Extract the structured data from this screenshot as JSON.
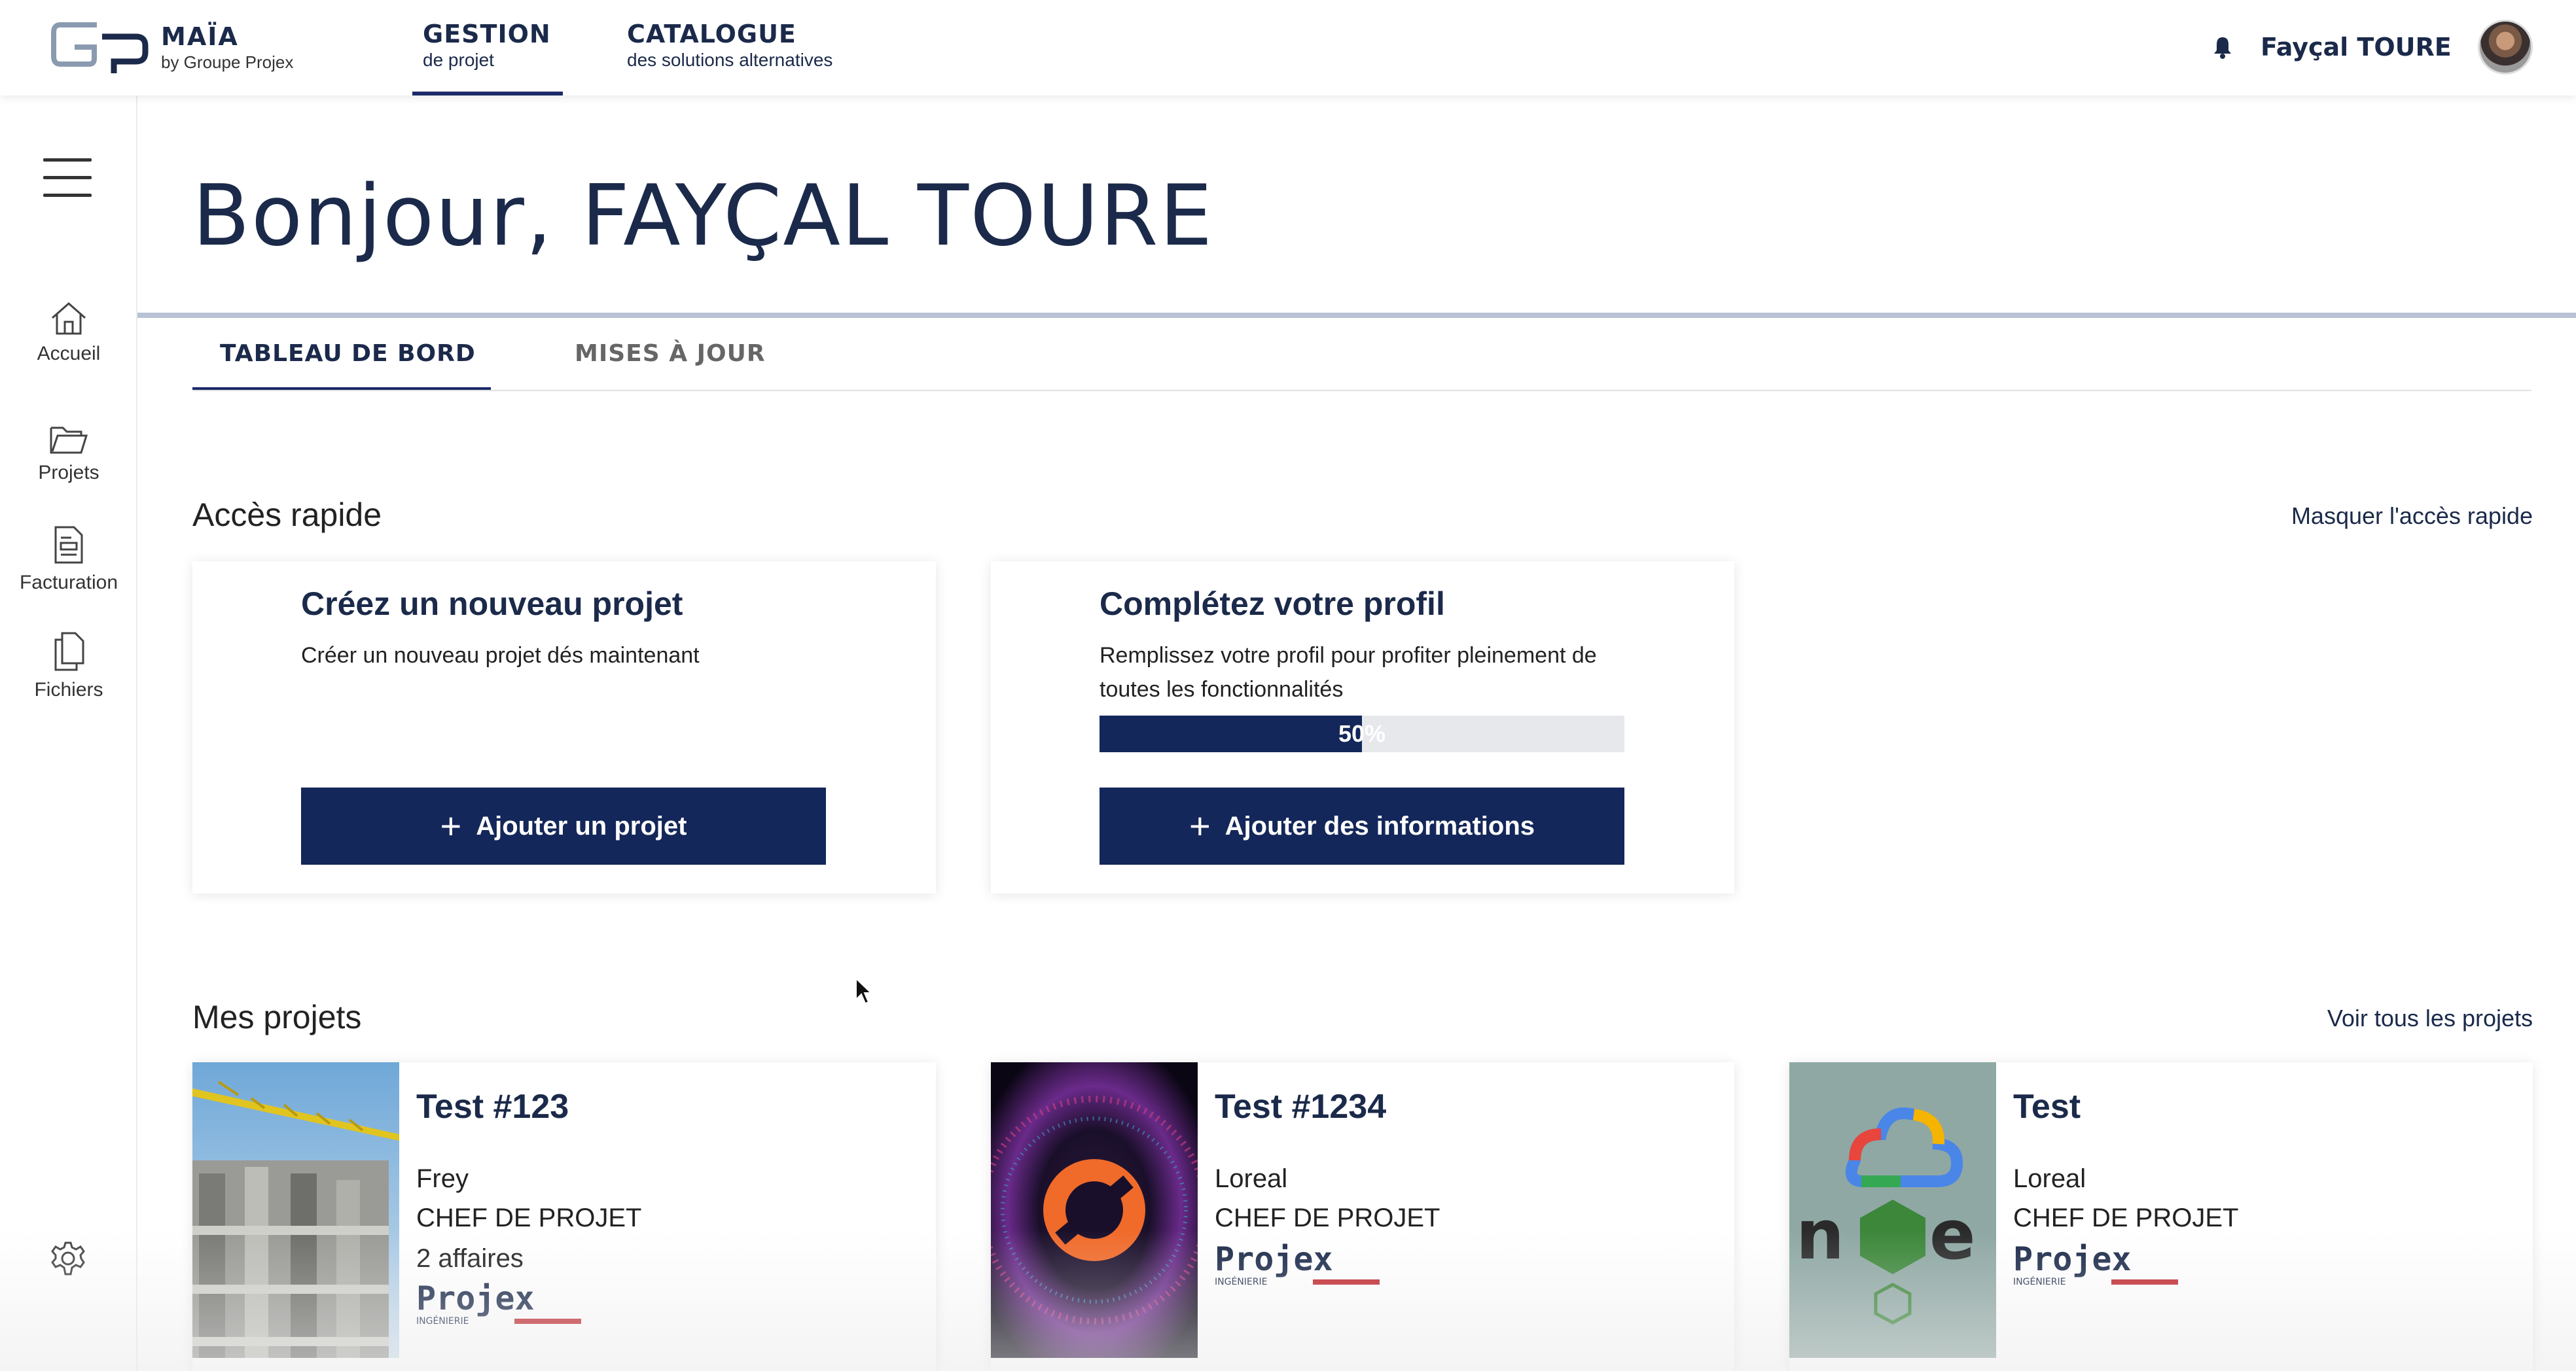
{
  "header": {
    "brand_name": "MAÏA",
    "brand_sub": "by Groupe Projex",
    "nav": [
      {
        "main": "GESTION",
        "sub": "de projet"
      },
      {
        "main": "CATALOGUE",
        "sub": "des solutions alternatives"
      }
    ],
    "bell_icon": "bell-icon",
    "user_name": "Fayçal TOURE"
  },
  "sidebar": {
    "menu_icon": "hamburger-menu-icon",
    "items": [
      {
        "icon": "home-icon",
        "label": "Accueil"
      },
      {
        "icon": "folder-icon",
        "label": "Projets"
      },
      {
        "icon": "invoice-icon",
        "label": "Facturation"
      },
      {
        "icon": "files-icon",
        "label": "Fichiers"
      }
    ],
    "settings_icon": "gear-icon"
  },
  "main": {
    "greeting": "Bonjour, FAYÇAL TOURE",
    "tabs": [
      {
        "label": "TABLEAU DE BORD",
        "active": true
      },
      {
        "label": "MISES À JOUR",
        "active": false
      }
    ]
  },
  "quick_access": {
    "title": "Accès rapide",
    "hide_link": "Masquer l'accès rapide",
    "cards": [
      {
        "title": "Créez un nouveau projet",
        "text": "Créer un nouveau projet dés maintenant",
        "button": "Ajouter un projet"
      },
      {
        "title": "Complétez votre profil",
        "text": "Remplissez votre profil pour profiter pleinement de toutes les fonctionnalités",
        "progress_percent": 50,
        "progress_label": "50%",
        "button": "Ajouter des informations"
      }
    ]
  },
  "projects": {
    "title": "Mes projets",
    "see_all_link": "Voir tous les projets",
    "items": [
      {
        "title": "Test #123",
        "client": "Frey",
        "role": "CHEF DE PROJET",
        "count": "2 affaires",
        "logo_text": "Projex",
        "logo_sub": "INGÉNIERIE"
      },
      {
        "title": "Test #1234",
        "client": "Loreal",
        "role": "CHEF DE PROJET",
        "logo_text": "Projex",
        "logo_sub": "INGÉNIERIE"
      },
      {
        "title": "Test",
        "client": "Loreal",
        "role": "CHEF DE PROJET",
        "logo_text": "Projex",
        "logo_sub": "INGÉNIERIE"
      }
    ]
  },
  "colors": {
    "primary": "#14275a",
    "text_dark": "#1b2a4a",
    "divider": "#b8c2d4",
    "projex_red": "#c0262d"
  }
}
